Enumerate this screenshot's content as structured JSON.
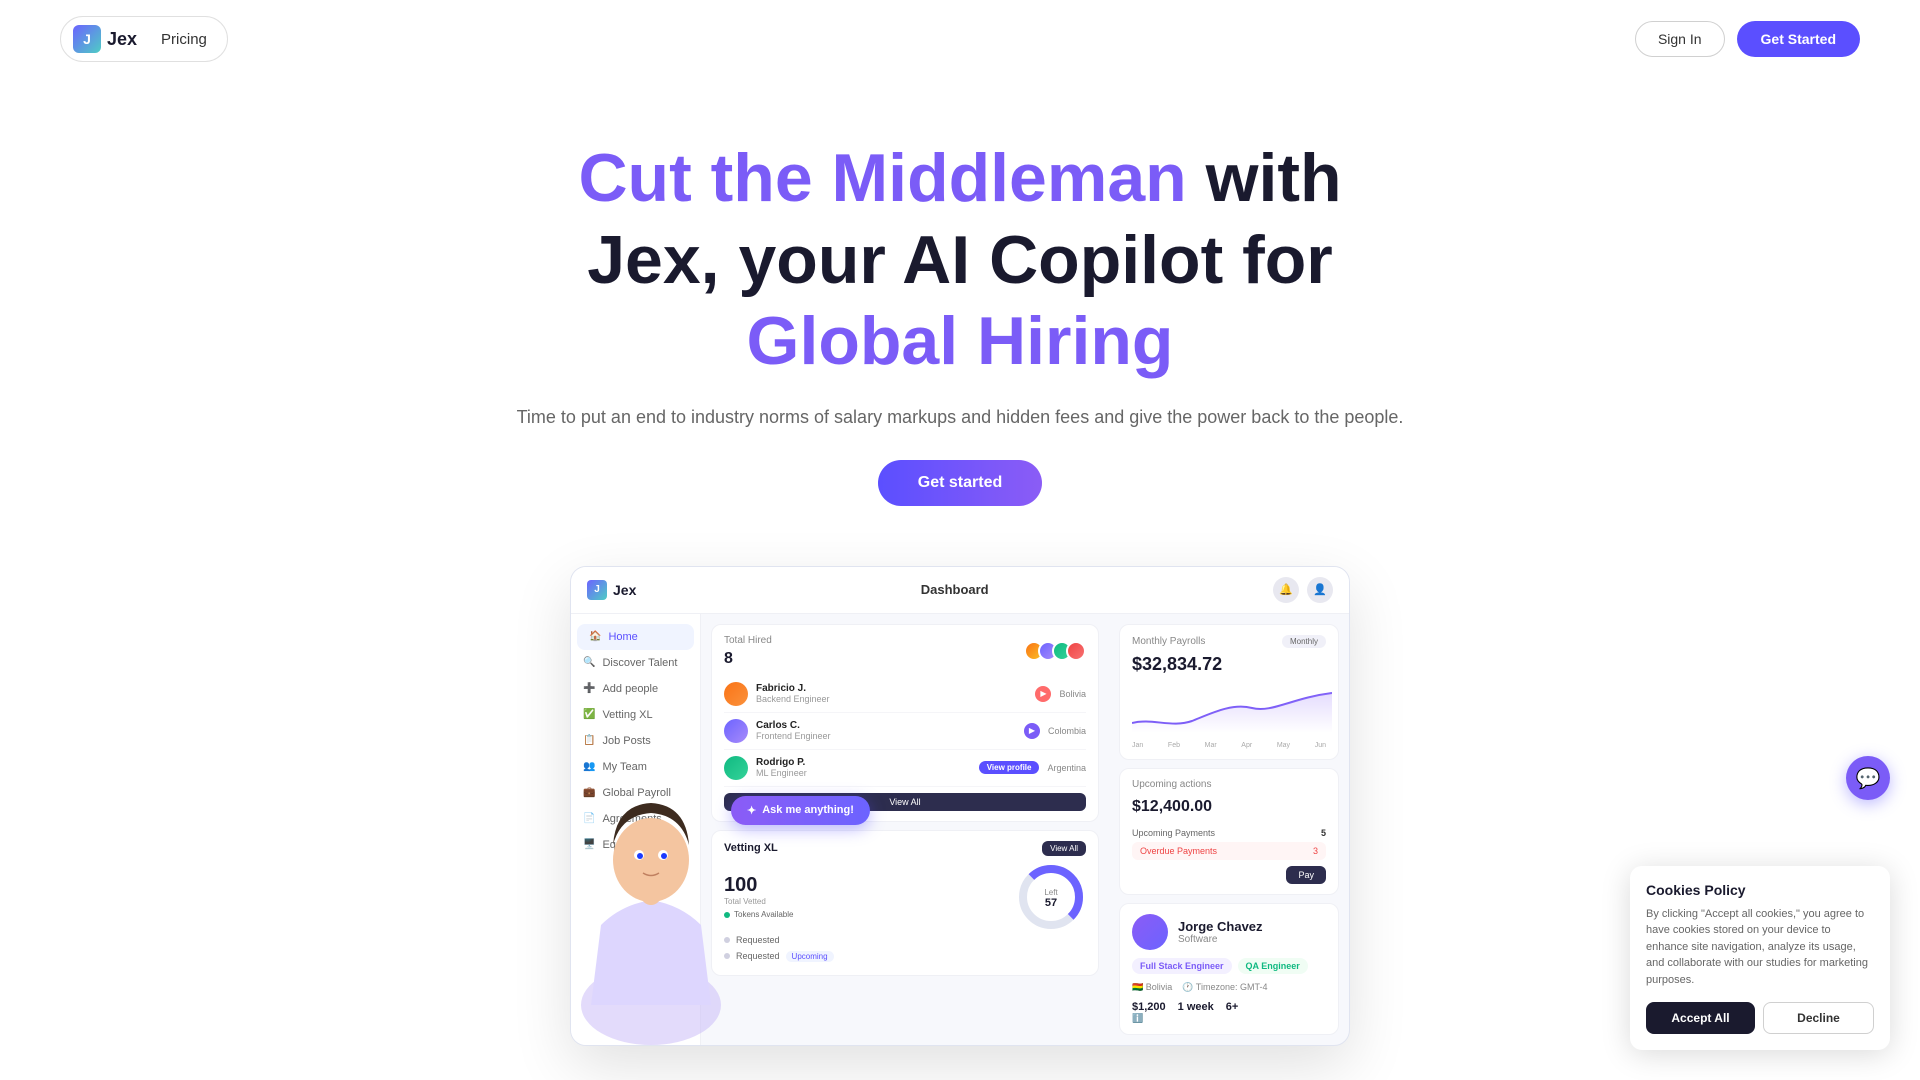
{
  "nav": {
    "logo_text": "Jex",
    "logo_letter": "J",
    "pricing_label": "Pricing",
    "signin_label": "Sign In",
    "get_started_label": "Get Started"
  },
  "hero": {
    "headline_part1": "Cut the Middleman with",
    "headline_part2": "Jex, your AI Copilot for",
    "headline_highlight": "Global Hiring",
    "subtext": "Time to put an end to industry norms of salary markups and hidden fees and give the power back to the people.",
    "cta_label": "Get started"
  },
  "dashboard": {
    "header": {
      "logo": "Jex",
      "title": "Dashboard"
    },
    "sidebar": {
      "items": [
        {
          "label": "Home",
          "active": true
        },
        {
          "label": "Discover Talent",
          "active": false
        },
        {
          "label": "Add people",
          "active": false
        },
        {
          "label": "Vetting XL",
          "active": false
        },
        {
          "label": "Job Posts",
          "active": false
        },
        {
          "label": "My Team",
          "active": false
        },
        {
          "label": "Global Payroll",
          "active": false
        },
        {
          "label": "Agreements",
          "active": false
        },
        {
          "label": "Equipments",
          "active": false
        }
      ]
    },
    "total_hired": {
      "label": "Total Hired",
      "value": "8"
    },
    "employees": [
      {
        "name": "Fabricio J.",
        "role": "Backend Engineer",
        "country": "Bolivia"
      },
      {
        "name": "Carlos C.",
        "role": "Frontend Engineer",
        "country": "Colombia"
      },
      {
        "name": "Rodrigo P.",
        "role": "ML Engineer",
        "country": "Argentina"
      }
    ],
    "view_all": "View All",
    "payroll": {
      "title": "Monthly Payrolls",
      "toggle": "Monthly",
      "amount": "$32,834.72",
      "chart_labels": [
        "Jan",
        "Feb",
        "Mar",
        "Apr",
        "May",
        "Jun"
      ]
    },
    "upcoming": {
      "title": "Upcoming actions",
      "amount": "$12,400.00",
      "payments_label": "Upcoming Payments",
      "payments_count": "5",
      "overdue_label": "Overdue Payments",
      "overdue_count": "3",
      "pay_btn": "Pay"
    },
    "vetting": {
      "title": "Vetting XL",
      "view_all": "View All",
      "requested_count": "100",
      "total_vetted": "Total Vetted",
      "left_label": "Left",
      "left_value": "57",
      "tokens_label": "Tokens Available",
      "rows": [
        {
          "label": "Requested",
          "badge": ""
        },
        {
          "label": "Requested",
          "badge": "Upcoming"
        }
      ]
    },
    "ai_btn": "Ask me anything!",
    "profile": {
      "name": "Jorge Chavez",
      "role": "Software",
      "tag1": "Full Stack Engineer",
      "tag2": "QA Engineer",
      "country": "Bolivia",
      "timezone": "GMT-4",
      "salary": "$1,200",
      "notice": "1 week",
      "experience": "6+"
    }
  },
  "cookies": {
    "title": "Cookies Policy",
    "text": "By clicking \"Accept all cookies,\" you agree to have cookies stored on your device to enhance site navigation, analyze its usage, and collaborate with our studies for marketing purposes.",
    "accept_label": "Accept All",
    "decline_label": "Decline"
  }
}
